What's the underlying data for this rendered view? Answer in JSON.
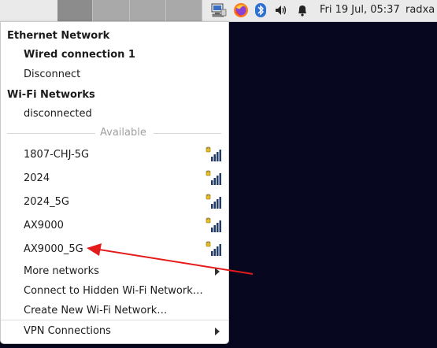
{
  "panel": {
    "clock": "Fri 19 Jul, 05:37",
    "user": "radxa"
  },
  "icons": {
    "network": "network-computer-icon",
    "firefox": "firefox-icon",
    "bluetooth": "bluetooth-icon",
    "volume": "volume-icon",
    "notifications": "bell-icon"
  },
  "menu": {
    "ethernet_header": "Ethernet Network",
    "wired_connection": "Wired connection 1",
    "disconnect": "Disconnect",
    "wifi_header": "Wi-Fi Networks",
    "wifi_status": "disconnected",
    "available_label": "Available",
    "networks": [
      "1807-CHJ-5G",
      "2024",
      "2024_5G",
      "AX9000",
      "AX9000_5G"
    ],
    "more_networks": "More networks",
    "connect_hidden": "Connect to Hidden Wi-Fi Network…",
    "create_new": "Create New Wi-Fi Network…",
    "vpn": "VPN Connections"
  },
  "colors": {
    "annotation_arrow": "#e41b1b",
    "signal_bars": "#203a6a",
    "lock": "#e8c020"
  }
}
